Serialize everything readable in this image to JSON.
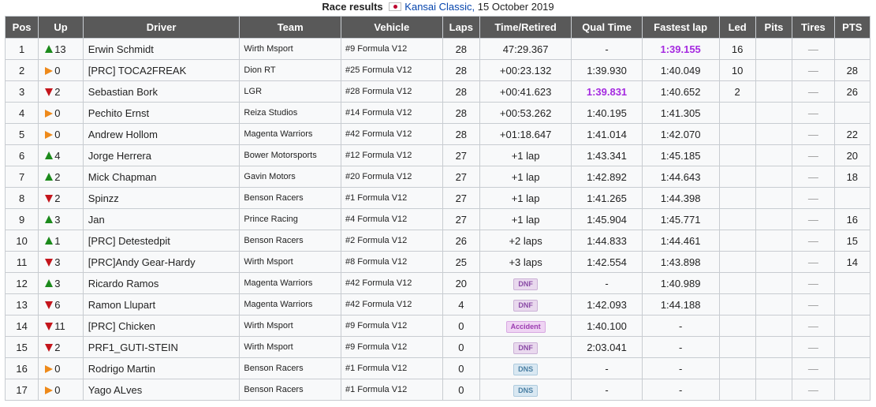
{
  "caption": {
    "title": "Race results",
    "event_link": "Kansai Classic,",
    "date": "15 October 2019"
  },
  "colors": {
    "header_bg": "#595959",
    "best_time": "#a52ae0",
    "gain": "#1c8a1c",
    "loss": "#c4151c",
    "same": "#ee8a1b"
  },
  "headers": [
    "Pos",
    "Up",
    "Driver",
    "Team",
    "Vehicle",
    "Laps",
    "Time/Retired",
    "Qual Time",
    "Fastest lap",
    "Led",
    "Pits",
    "Tires",
    "PTS"
  ],
  "rows": [
    {
      "pos": "1",
      "dir": "up",
      "up": "13",
      "driver": "Erwin Schmidt",
      "team": "Wirth Msport",
      "vehicle": "#9 Formula V12",
      "laps": "28",
      "time": "47:29.367",
      "time_badge": "",
      "qual": "-",
      "qual_best": false,
      "fastest": "1:39.155",
      "fastest_best": true,
      "led": "16",
      "pits": "",
      "tires": "—",
      "pts": ""
    },
    {
      "pos": "2",
      "dir": "same",
      "up": "0",
      "driver": "[PRC] TOCA2FREAK",
      "team": "Dion RT",
      "vehicle": "#25 Formula V12",
      "laps": "28",
      "time": "+00:23.132",
      "time_badge": "",
      "qual": "1:39.930",
      "qual_best": false,
      "fastest": "1:40.049",
      "fastest_best": false,
      "led": "10",
      "pits": "",
      "tires": "—",
      "pts": "28"
    },
    {
      "pos": "3",
      "dir": "down",
      "up": "2",
      "driver": "Sebastian Bork",
      "team": "LGR",
      "vehicle": "#28 Formula V12",
      "laps": "28",
      "time": "+00:41.623",
      "time_badge": "",
      "qual": "1:39.831",
      "qual_best": true,
      "fastest": "1:40.652",
      "fastest_best": false,
      "led": "2",
      "pits": "",
      "tires": "—",
      "pts": "26"
    },
    {
      "pos": "4",
      "dir": "same",
      "up": "0",
      "driver": "Pechito Ernst",
      "team": "Reiza Studios",
      "vehicle": "#14 Formula V12",
      "laps": "28",
      "time": "+00:53.262",
      "time_badge": "",
      "qual": "1:40.195",
      "qual_best": false,
      "fastest": "1:41.305",
      "fastest_best": false,
      "led": "",
      "pits": "",
      "tires": "—",
      "pts": ""
    },
    {
      "pos": "5",
      "dir": "same",
      "up": "0",
      "driver": "Andrew Hollom",
      "team": "Magenta Warriors",
      "vehicle": "#42 Formula V12",
      "laps": "28",
      "time": "+01:18.647",
      "time_badge": "",
      "qual": "1:41.014",
      "qual_best": false,
      "fastest": "1:42.070",
      "fastest_best": false,
      "led": "",
      "pits": "",
      "tires": "—",
      "pts": "22"
    },
    {
      "pos": "6",
      "dir": "up",
      "up": "4",
      "driver": "Jorge Herrera",
      "team": "Bower Motorsports",
      "vehicle": "#12 Formula V12",
      "laps": "27",
      "time": "+1 lap",
      "time_badge": "",
      "qual": "1:43.341",
      "qual_best": false,
      "fastest": "1:45.185",
      "fastest_best": false,
      "led": "",
      "pits": "",
      "tires": "—",
      "pts": "20"
    },
    {
      "pos": "7",
      "dir": "up",
      "up": "2",
      "driver": "Mick Chapman",
      "team": "Gavin Motors",
      "vehicle": "#20 Formula V12",
      "laps": "27",
      "time": "+1 lap",
      "time_badge": "",
      "qual": "1:42.892",
      "qual_best": false,
      "fastest": "1:44.643",
      "fastest_best": false,
      "led": "",
      "pits": "",
      "tires": "—",
      "pts": "18"
    },
    {
      "pos": "8",
      "dir": "down",
      "up": "2",
      "driver": "Spinzz",
      "team": "Benson Racers",
      "vehicle": "#1 Formula V12",
      "laps": "27",
      "time": "+1 lap",
      "time_badge": "",
      "qual": "1:41.265",
      "qual_best": false,
      "fastest": "1:44.398",
      "fastest_best": false,
      "led": "",
      "pits": "",
      "tires": "—",
      "pts": ""
    },
    {
      "pos": "9",
      "dir": "up",
      "up": "3",
      "driver": "Jan",
      "team": "Prince Racing",
      "vehicle": "#4 Formula V12",
      "laps": "27",
      "time": "+1 lap",
      "time_badge": "",
      "qual": "1:45.904",
      "qual_best": false,
      "fastest": "1:45.771",
      "fastest_best": false,
      "led": "",
      "pits": "",
      "tires": "—",
      "pts": "16"
    },
    {
      "pos": "10",
      "dir": "up",
      "up": "1",
      "driver": "[PRC] Detestedpit",
      "team": "Benson Racers",
      "vehicle": "#2 Formula V12",
      "laps": "26",
      "time": "+2 laps",
      "time_badge": "",
      "qual": "1:44.833",
      "qual_best": false,
      "fastest": "1:44.461",
      "fastest_best": false,
      "led": "",
      "pits": "",
      "tires": "—",
      "pts": "15"
    },
    {
      "pos": "11",
      "dir": "down",
      "up": "3",
      "driver": "[PRC]Andy Gear-Hardy",
      "team": "Wirth Msport",
      "vehicle": "#8 Formula V12",
      "laps": "25",
      "time": "+3 laps",
      "time_badge": "",
      "qual": "1:42.554",
      "qual_best": false,
      "fastest": "1:43.898",
      "fastest_best": false,
      "led": "",
      "pits": "",
      "tires": "—",
      "pts": "14"
    },
    {
      "pos": "12",
      "dir": "up",
      "up": "3",
      "driver": "Ricardo Ramos",
      "team": "Magenta Warriors",
      "vehicle": "#42 Formula V12",
      "laps": "20",
      "time": "",
      "time_badge": "DNF",
      "qual": "-",
      "qual_best": false,
      "fastest": "1:40.989",
      "fastest_best": false,
      "led": "",
      "pits": "",
      "tires": "—",
      "pts": ""
    },
    {
      "pos": "13",
      "dir": "down",
      "up": "6",
      "driver": "Ramon Llupart",
      "team": "Magenta Warriors",
      "vehicle": "#42 Formula V12",
      "laps": "4",
      "time": "",
      "time_badge": "DNF",
      "qual": "1:42.093",
      "qual_best": false,
      "fastest": "1:44.188",
      "fastest_best": false,
      "led": "",
      "pits": "",
      "tires": "—",
      "pts": ""
    },
    {
      "pos": "14",
      "dir": "down",
      "up": "11",
      "driver": "[PRC] Chicken",
      "team": "Wirth Msport",
      "vehicle": "#9 Formula V12",
      "laps": "0",
      "time": "",
      "time_badge": "Accident",
      "qual": "1:40.100",
      "qual_best": false,
      "fastest": "-",
      "fastest_best": false,
      "led": "",
      "pits": "",
      "tires": "—",
      "pts": ""
    },
    {
      "pos": "15",
      "dir": "down",
      "up": "2",
      "driver": "PRF1_GUTI-STEIN",
      "team": "Wirth Msport",
      "vehicle": "#9 Formula V12",
      "laps": "0",
      "time": "",
      "time_badge": "DNF",
      "qual": "2:03.041",
      "qual_best": false,
      "fastest": "-",
      "fastest_best": false,
      "led": "",
      "pits": "",
      "tires": "—",
      "pts": ""
    },
    {
      "pos": "16",
      "dir": "same",
      "up": "0",
      "driver": "Rodrigo Martin",
      "team": "Benson Racers",
      "vehicle": "#1 Formula V12",
      "laps": "0",
      "time": "",
      "time_badge": "DNS",
      "qual": "-",
      "qual_best": false,
      "fastest": "-",
      "fastest_best": false,
      "led": "",
      "pits": "",
      "tires": "—",
      "pts": ""
    },
    {
      "pos": "17",
      "dir": "same",
      "up": "0",
      "driver": "Yago ALves",
      "team": "Benson Racers",
      "vehicle": "#1 Formula V12",
      "laps": "0",
      "time": "",
      "time_badge": "DNS",
      "qual": "-",
      "qual_best": false,
      "fastest": "-",
      "fastest_best": false,
      "led": "",
      "pits": "",
      "tires": "—",
      "pts": ""
    }
  ]
}
